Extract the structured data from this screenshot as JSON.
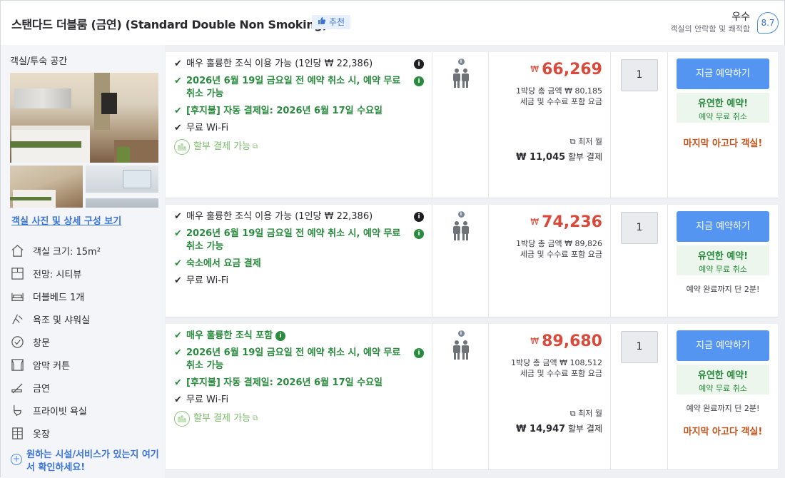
{
  "header": {
    "room_title": "스탠다드 더블룸 (금연) (Standard Double Non Smoking)",
    "recommend": "추천",
    "rating_word": "우수",
    "rating_sub": "객실의 안락함 및 쾌적함",
    "rating_score": "8.7"
  },
  "left": {
    "space_label": "객실/투숙 공간",
    "photo_link": "객실 사진 및 상세 구성 보기",
    "amenities": [
      {
        "icon": "house-icon",
        "label": "객실 크기: 15m²"
      },
      {
        "icon": "window-view-icon",
        "label": "전망: 시티뷰"
      },
      {
        "icon": "bed-icon",
        "label": "더블베드 1개"
      },
      {
        "icon": "shower-icon",
        "label": "욕조 및 샤워실"
      },
      {
        "icon": "checkmark-circle-icon",
        "label": "창문"
      },
      {
        "icon": "curtain-icon",
        "label": "암막 커튼"
      },
      {
        "icon": "no-smoking-icon",
        "label": "금연"
      },
      {
        "icon": "bathroom-icon",
        "label": "프라이빗 욕실"
      },
      {
        "icon": "wardrobe-icon",
        "label": "옷장"
      }
    ],
    "more_link": "원하는 시설/서비스가 있는지 여기서 확인하세요!"
  },
  "offers": [
    {
      "benefits": [
        {
          "style": "plain",
          "text": "매우 훌륭한 조식 이용 가능 (1인당 ₩ 22,386)",
          "info": "dark"
        },
        {
          "style": "green",
          "text": "2026년 6월 19일 금요일 전 예약 취소 시, 예약 무료 취소 가능",
          "info": "green"
        },
        {
          "style": "green",
          "text": "[후지불] 자동 결제일: 2026년 6월 17일 수요일",
          "info": ""
        },
        {
          "style": "plain",
          "text": "무료 Wi-Fi",
          "info": ""
        },
        {
          "style": "pay",
          "text": "할부 결제 가능",
          "info": ""
        }
      ],
      "currency": "₩",
      "price": "66,269",
      "total": "1박당 총 금액 ₩ 80,185",
      "tax": "세금 및 수수료 포함 요금",
      "min_label": "최저 월",
      "installment_amount": "₩ 11,045",
      "installment_label": "할부 결제",
      "qty": "1",
      "book_label": "지금 예약하기",
      "flex_title": "유연한 예약!",
      "flex_sub": "예약 무료 취소",
      "remain": "",
      "last_room": "마지막 아고다 객실!"
    },
    {
      "benefits": [
        {
          "style": "plain",
          "text": "매우 훌륭한 조식 이용 가능 (1인당 ₩ 22,386)",
          "info": "dark"
        },
        {
          "style": "green",
          "text": "2026년 6월 19일 금요일 전 예약 취소 시, 예약 무료 취소 가능",
          "info": "green"
        },
        {
          "style": "green",
          "text": "숙소에서 요금 결제",
          "info": ""
        },
        {
          "style": "plain",
          "text": "무료 Wi-Fi",
          "info": ""
        }
      ],
      "currency": "₩",
      "price": "74,236",
      "total": "1박당 총 금액 ₩ 89,826",
      "tax": "세금 및 수수료 포함 요금",
      "min_label": "",
      "installment_amount": "",
      "installment_label": "",
      "qty": "1",
      "book_label": "지금 예약하기",
      "flex_title": "유연한 예약!",
      "flex_sub": "예약 무료 취소",
      "remain": "예약 완료까지 단 2분!",
      "last_room": ""
    },
    {
      "benefits": [
        {
          "style": "green",
          "text": "매우 훌륭한 조식 포함",
          "info": "green"
        },
        {
          "style": "green",
          "text": "2026년 6월 19일 금요일 전 예약 취소 시, 예약 무료 취소 가능",
          "info": "green"
        },
        {
          "style": "green",
          "text": "[후지불] 자동 결제일: 2026년 6월 17일 수요일",
          "info": ""
        },
        {
          "style": "plain",
          "text": "무료 Wi-Fi",
          "info": ""
        },
        {
          "style": "pay",
          "text": "할부 결제 가능",
          "info": ""
        }
      ],
      "currency": "₩",
      "price": "89,680",
      "total": "1박당 총 금액 ₩ 108,512",
      "tax": "세금 및 수수료 포함 요금",
      "min_label": "최저 월",
      "installment_amount": "₩ 14,947",
      "installment_label": "할부 결제",
      "qty": "1",
      "book_label": "지금 예약하기",
      "flex_title": "유연한 예약!",
      "flex_sub": "예약 무료 취소",
      "remain": "예약 완료까지 단 2분!",
      "last_room": "마지막 아고다 객실!"
    }
  ],
  "colors": {
    "accent_blue": "#5395f0",
    "price_red": "#d94a3a",
    "green": "#2a8a3e",
    "orange": "#c4541c"
  }
}
